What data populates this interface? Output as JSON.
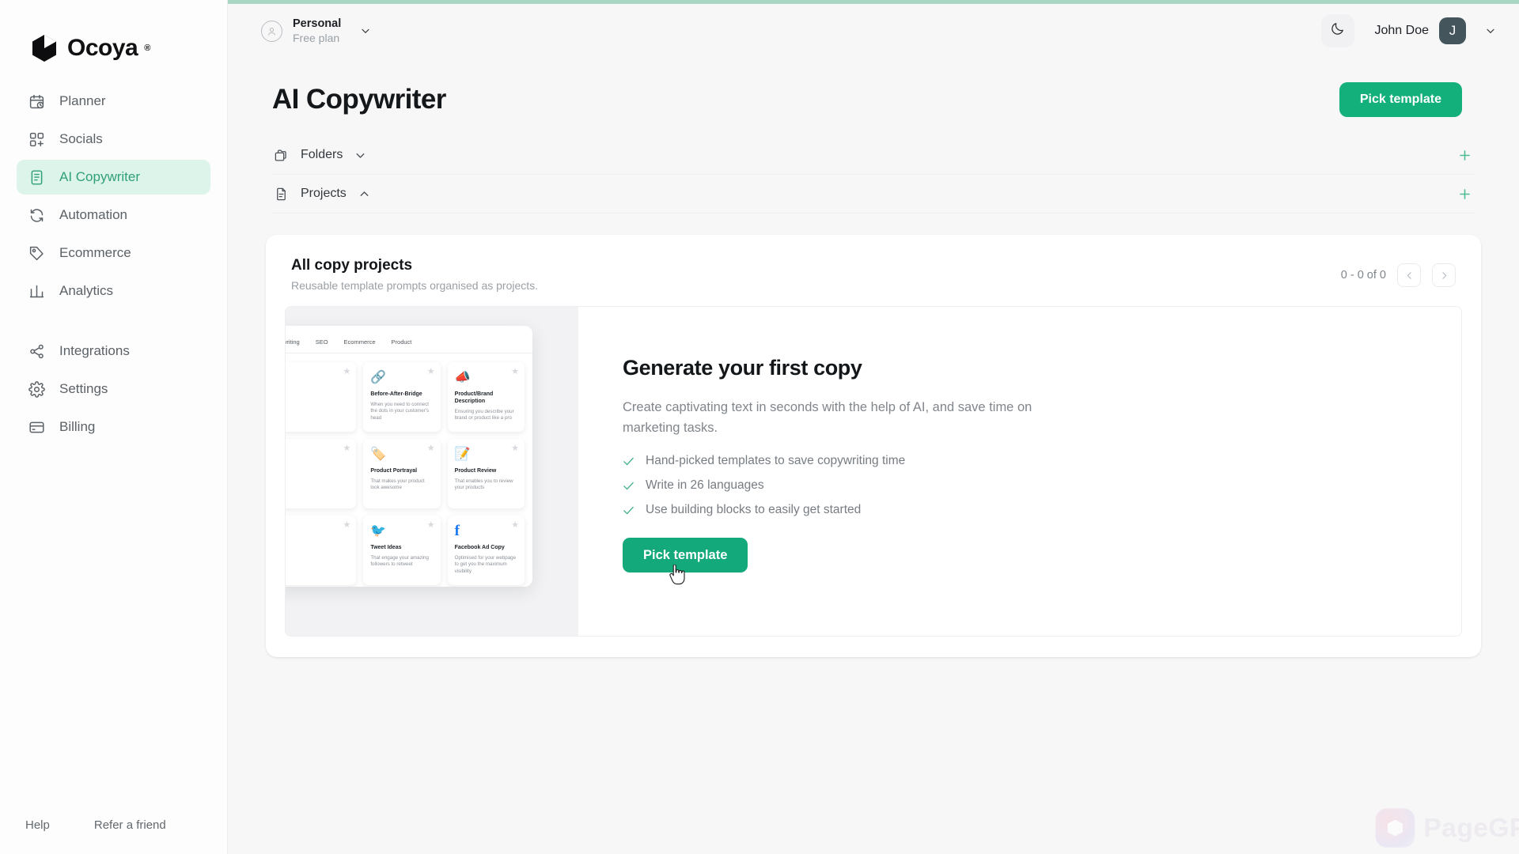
{
  "brand": {
    "name": "Ocoya",
    "registered": "®",
    "logo_icon": "cube-logo-icon"
  },
  "sidebar": {
    "items": [
      {
        "label": "Planner",
        "icon": "calendar-clock-icon",
        "active": false
      },
      {
        "label": "Socials",
        "icon": "grid-plus-icon",
        "active": false
      },
      {
        "label": "AI Copywriter",
        "icon": "document-lines-icon",
        "active": true
      },
      {
        "label": "Automation",
        "icon": "refresh-cycle-icon",
        "active": false
      },
      {
        "label": "Ecommerce",
        "icon": "tag-icon",
        "active": false
      },
      {
        "label": "Analytics",
        "icon": "bar-chart-icon",
        "active": false
      },
      {
        "label": "Integrations",
        "icon": "share-nodes-icon",
        "active": false
      },
      {
        "label": "Settings",
        "icon": "gear-icon",
        "active": false
      },
      {
        "label": "Billing",
        "icon": "credit-card-icon",
        "active": false
      }
    ],
    "footer": {
      "help": "Help",
      "refer": "Refer a friend"
    }
  },
  "topbar": {
    "workspace_name": "Personal",
    "workspace_plan": "Free plan",
    "workspace_icon": "user-circle-icon",
    "workspace_caret": "chevron-down-icon",
    "theme_toggle_icon": "moon-icon",
    "user_name": "John Doe",
    "user_initial": "J",
    "user_caret": "chevron-down-icon"
  },
  "page": {
    "title": "AI Copywriter",
    "primary_action": "Pick template"
  },
  "sections": [
    {
      "label": "Folders",
      "icon": "folders-icon",
      "caret": "chevron-down-icon",
      "add": "plus-icon"
    },
    {
      "label": "Projects",
      "icon": "document-icon",
      "caret": "chevron-up-icon",
      "add": "plus-icon"
    }
  ],
  "panel": {
    "title": "All copy projects",
    "subtitle": "Reusable template prompts organised as projects.",
    "pager": {
      "count": "0 - 0 of 0",
      "prev_icon": "chevron-left-icon",
      "next_icon": "chevron-right-icon"
    }
  },
  "empty_state": {
    "title": "Generate your first copy",
    "description": "Create captivating text in seconds with the help of AI, and save time on marketing tasks.",
    "bullets": [
      "Hand-picked templates to save copywriting time",
      "Write in 26 languages",
      "Use building blocks to easily get started"
    ],
    "cta": "Pick template",
    "illustration": {
      "tabs": [
        "writing",
        "SEO",
        "Ecommerce",
        "Product"
      ],
      "cards": [
        {
          "name": "",
          "desc": "",
          "icon": "",
          "star": "★"
        },
        {
          "name": "Before-After-Bridge",
          "desc": "When you need to connect the dots in your customer's head",
          "icon": "🔗",
          "star": "★"
        },
        {
          "name": "Product/Brand Description",
          "desc": "Ensuring you describe your brand or product like a pro",
          "icon": "📣",
          "star": "★"
        },
        {
          "name": "",
          "desc": "",
          "icon": "",
          "star": "★"
        },
        {
          "name": "Product Portrayal",
          "desc": "That makes your product look awesome",
          "icon": "🏷️",
          "star": "★"
        },
        {
          "name": "Product Review",
          "desc": "That enables you to review your products",
          "icon": "📝",
          "star": "★"
        },
        {
          "name": "",
          "desc": "",
          "icon": "",
          "star": "★"
        },
        {
          "name": "Tweet Ideas",
          "desc": "That engage your amazing followers to retweet",
          "icon": "🐦",
          "star": "★"
        },
        {
          "name": "Facebook Ad Copy",
          "desc": "Optimised for your webpage to get you the maximum visibility",
          "icon": "f",
          "star": "★"
        }
      ]
    }
  },
  "watermark": {
    "text": "PageGPT"
  },
  "colors": {
    "accent_green": "#13b07c",
    "accent_green_soft": "#ddf4ea",
    "accent_green_text": "#2fa077",
    "page_bg": "#f7f7f8",
    "sidebar_bg": "#fdfdfd",
    "loading_bar": "#a9d7c4"
  }
}
